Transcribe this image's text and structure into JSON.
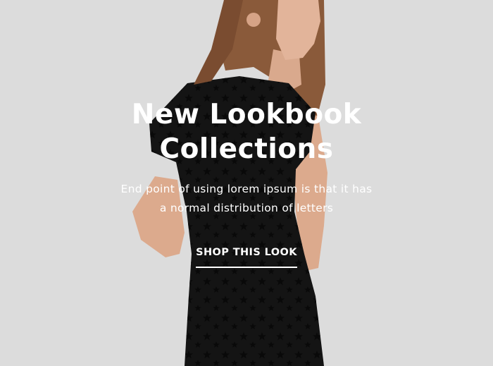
{
  "hero": {
    "title_line1": "New Lookbook",
    "title_line2": "Collections",
    "description_line1": "End point of using lorem ipsum is that it has",
    "description_line2": "a normal distribution of letters",
    "cta_label": "SHOP THIS LOOK",
    "background_color": "#dcdcdc",
    "text_color": "#ffffff",
    "dress_color": "#141414"
  }
}
